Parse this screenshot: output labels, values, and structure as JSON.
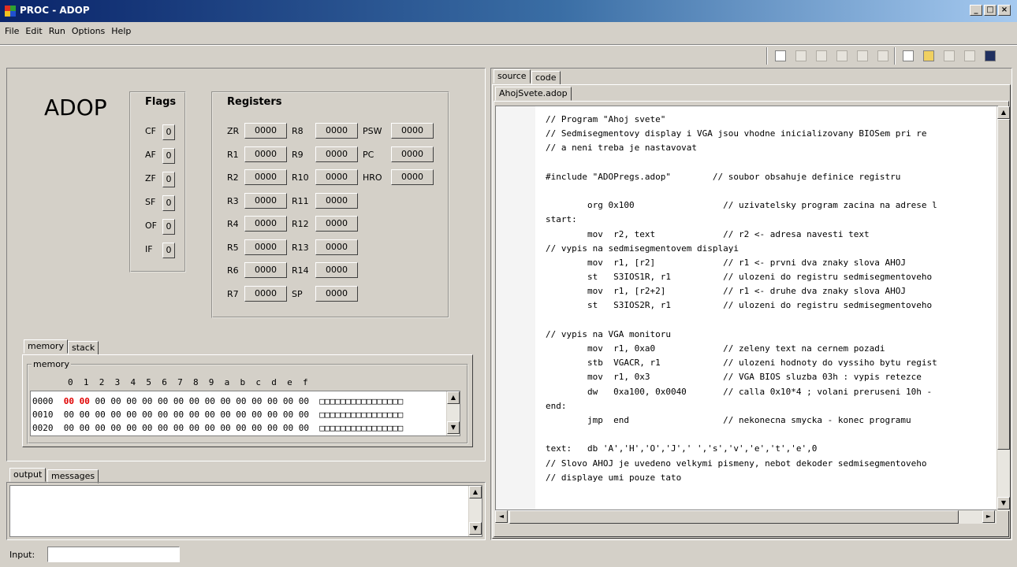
{
  "window": {
    "title": "PROC - ADOP",
    "controls": [
      "_",
      "□",
      "×"
    ]
  },
  "menu": [
    "File",
    "Edit",
    "Run",
    "Options",
    "Help"
  ],
  "toolbar": {
    "icons": [
      "open-file-icon",
      "step-icon",
      "run-icon",
      "pause-icon",
      "stop-icon",
      "reset-icon",
      "new-file-icon",
      "load-icon",
      "save-disabled-icon",
      "save-all-disabled-icon",
      "save-icon"
    ]
  },
  "app_label": "ADOP",
  "flags": {
    "title": "Flags",
    "items": [
      {
        "name": "CF",
        "value": "0"
      },
      {
        "name": "AF",
        "value": "0"
      },
      {
        "name": "ZF",
        "value": "0"
      },
      {
        "name": "SF",
        "value": "0"
      },
      {
        "name": "OF",
        "value": "0"
      },
      {
        "name": "IF",
        "value": "0"
      }
    ]
  },
  "registers": {
    "title": "Registers",
    "col1": [
      {
        "name": "ZR",
        "value": "0000"
      },
      {
        "name": "R1",
        "value": "0000"
      },
      {
        "name": "R2",
        "value": "0000"
      },
      {
        "name": "R3",
        "value": "0000"
      },
      {
        "name": "R4",
        "value": "0000"
      },
      {
        "name": "R5",
        "value": "0000"
      },
      {
        "name": "R6",
        "value": "0000"
      },
      {
        "name": "R7",
        "value": "0000"
      }
    ],
    "col2": [
      {
        "name": "R8",
        "value": "0000"
      },
      {
        "name": "R9",
        "value": "0000"
      },
      {
        "name": "R10",
        "value": "0000"
      },
      {
        "name": "R11",
        "value": "0000"
      },
      {
        "name": "R12",
        "value": "0000"
      },
      {
        "name": "R13",
        "value": "0000"
      },
      {
        "name": "R14",
        "value": "0000"
      },
      {
        "name": "SP",
        "value": "0000"
      }
    ],
    "col3": [
      {
        "name": "PSW",
        "value": "0000"
      },
      {
        "name": "PC",
        "value": "0000"
      },
      {
        "name": "HRO",
        "value": "0000"
      }
    ]
  },
  "memory_tabs": [
    "memory",
    "stack"
  ],
  "memory": {
    "group_title": "memory",
    "header": "0  1  2  3  4  5  6  7  8  9  a  b  c  d  e  f",
    "rows": [
      {
        "addr": "0000",
        "hl": "00 00",
        "bytes": " 00 00 00 00 00 00 00 00 00 00 00 00 00 00",
        "ascii": "□□□□□□□□□□□□□□□□"
      },
      {
        "addr": "0010",
        "hl": "",
        "bytes": "00 00 00 00 00 00 00 00 00 00 00 00 00 00 00 00",
        "ascii": "□□□□□□□□□□□□□□□□"
      },
      {
        "addr": "0020",
        "hl": "",
        "bytes": "00 00 00 00 00 00 00 00 00 00 00 00 00 00 00 00",
        "ascii": "□□□□□□□□□□□□□□□□"
      }
    ]
  },
  "output_tabs": [
    "output",
    "messages"
  ],
  "input": {
    "label": "Input:",
    "value": ""
  },
  "editor_tabs": [
    "source",
    "code"
  ],
  "file_tab": "AhojSvete.adop",
  "source_lines": [
    "// Program \"Ahoj svete\"",
    "// Sedmisegmentovy display i VGA jsou vhodne inicializovany BIOSem pri re",
    "// a neni treba je nastavovat",
    "",
    "#include \"ADOPregs.adop\"        // soubor obsahuje definice registru",
    "",
    "        org 0x100                 // uzivatelsky program zacina na adrese l",
    "start:",
    "        mov  r2, text             // r2 <- adresa navesti text",
    "// vypis na sedmisegmentovem displayi",
    "        mov  r1, [r2]             // r1 <- prvni dva znaky slova AHOJ",
    "        st   S3IOS1R, r1          // ulozeni do registru sedmisegmentoveho",
    "        mov  r1, [r2+2]           // r1 <- druhe dva znaky slova AHOJ",
    "        st   S3IOS2R, r1          // ulozeni do registru sedmisegmentoveho",
    "",
    "// vypis na VGA monitoru",
    "        mov  r1, 0xa0             // zeleny text na cernem pozadi",
    "        stb  VGACR, r1            // ulozeni hodnoty do vyssiho bytu regist",
    "        mov  r1, 0x3              // VGA BIOS sluzba 03h : vypis retezce",
    "        dw   0xa100, 0x0040       // calla 0x10*4 ; volani preruseni 10h -",
    "end:",
    "        jmp  end                  // nekonecna smycka - konec programu",
    "",
    "text:   db 'A','H','O','J',' ','s','v','e','t','e',0",
    "// Slovo AHOJ je uvedeno velkymi pismeny, nebot dekoder sedmisegmentoveho",
    "// displaye umi pouze tato"
  ]
}
